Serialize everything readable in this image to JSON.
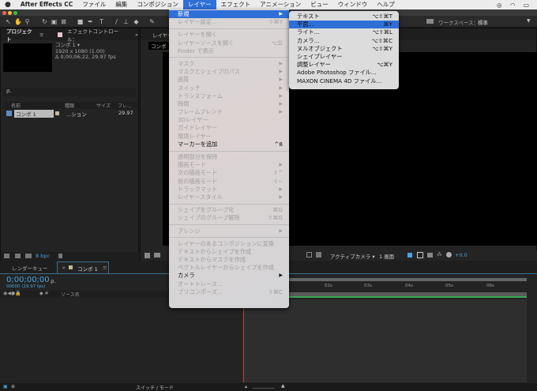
{
  "menubar": {
    "apple": "",
    "items": [
      "After Effects CC",
      "ファイル",
      "編集",
      "コンポジション",
      "レイヤー",
      "エフェクト",
      "アニメーション",
      "ビュー",
      "ウィンドウ",
      "ヘルプ"
    ],
    "active": "レイヤー"
  },
  "toolbar": {
    "workspace_label": "ワークスペース：",
    "workspace_value": "標準"
  },
  "project": {
    "tab": "プロジェクト",
    "effects_tab": "エフェクトコントロール：",
    "comp_name": "コンポ 1 ▾",
    "comp_res": "1920 x 1080 (1.00)",
    "comp_dur": "Δ 0;00;06;22, 29.97 fps",
    "search_placeholder": "ρ.",
    "columns": [
      "名前",
      "種類",
      "サイズ",
      "フレ..."
    ],
    "rows": [
      {
        "name": "コンポ 1",
        "type": "...ション",
        "fps": "29.97"
      }
    ],
    "bpc": "8 bpc"
  },
  "viewer": {
    "tab": "レイヤー",
    "comp_tab": "コンポ",
    "camera": "アクティブカメラ ▾",
    "views": "1 画面",
    "exposure": "+0.0"
  },
  "timeline": {
    "render_tab": "レンダーキュー",
    "comp_tab": "コンポ 1",
    "timecode": "0;00;00;00",
    "frames": "00000 (29.97 fps)",
    "source_col": "ソース名",
    "ruler": [
      "02s",
      "03s",
      "04s",
      "05s",
      "06s"
    ],
    "switch_mode": "スイッチ / モード"
  },
  "layer_menu": [
    {
      "label": "新規",
      "sub": true,
      "enabled": true,
      "highlight": true
    },
    {
      "label": "レイヤー設定...",
      "shortcut": "⇧⌘Y"
    },
    {
      "sep": true
    },
    {
      "label": "レイヤーを開く"
    },
    {
      "label": "レイヤーソースを開く",
      "shortcut": "⌥☰"
    },
    {
      "label": "Finder で表示"
    },
    {
      "sep": true
    },
    {
      "label": "マスク",
      "sub": true
    },
    {
      "label": "マスクとシェイプのパス",
      "sub": true
    },
    {
      "label": "画質",
      "sub": true
    },
    {
      "label": "スイッチ",
      "sub": true
    },
    {
      "label": "トランスフォーム",
      "sub": true
    },
    {
      "label": "時間",
      "sub": true
    },
    {
      "label": "フレームブレンド",
      "sub": true
    },
    {
      "label": "3Dレイヤー"
    },
    {
      "label": "ガイドレイヤー"
    },
    {
      "label": "環境レイヤー"
    },
    {
      "label": "マーカーを追加",
      "shortcut": "^8",
      "enabled": true
    },
    {
      "sep": true
    },
    {
      "label": "透明部分を保持"
    },
    {
      "label": "描画モード",
      "sub": true
    },
    {
      "label": "次の描画モード",
      "shortcut": "⇧^"
    },
    {
      "label": "前の描画モード",
      "shortcut": "⇧−"
    },
    {
      "label": "トラックマット",
      "sub": true
    },
    {
      "label": "レイヤースタイル",
      "sub": true
    },
    {
      "sep": true
    },
    {
      "label": "シェイプをグループ化",
      "shortcut": "⌘G"
    },
    {
      "label": "シェイプのグループ解除",
      "shortcut": "⇧⌘G"
    },
    {
      "sep": true
    },
    {
      "label": "アレンジ",
      "sub": true
    },
    {
      "sep": true
    },
    {
      "label": "レイヤーのあるコンポジションに変換"
    },
    {
      "label": "テキストからシェイプを作成"
    },
    {
      "label": "テキストからマスクを作成"
    },
    {
      "label": "ベクトルレイヤーからシェイプを作成"
    },
    {
      "label": "カメラ",
      "sub": true,
      "enabled": true
    },
    {
      "label": "オートトレース..."
    },
    {
      "label": "プリコンポーズ...",
      "shortcut": "⇧⌘C"
    }
  ],
  "new_submenu": [
    {
      "label": "テキスト",
      "shortcut": "⌥⇧⌘T"
    },
    {
      "label": "平面...",
      "shortcut": "⌘Y",
      "highlight": true
    },
    {
      "label": "ライト...",
      "shortcut": "⌥⇧⌘L"
    },
    {
      "label": "カメラ...",
      "shortcut": "⌥⇧⌘C"
    },
    {
      "label": "ヌルオブジェクト",
      "shortcut": "⌥⇧⌘Y"
    },
    {
      "label": "シェイプレイヤー"
    },
    {
      "label": "調整レイヤー",
      "shortcut": "⌥⌘Y"
    },
    {
      "label": "Adobe Photoshop ファイル..."
    },
    {
      "label": "MAXON CINEMA 4D ファイル..."
    }
  ],
  "colors": {
    "accent": "#2f6fd8",
    "timecode": "#4aa3e0",
    "playhead": "#c0392b",
    "work_area": "#3aa757"
  }
}
